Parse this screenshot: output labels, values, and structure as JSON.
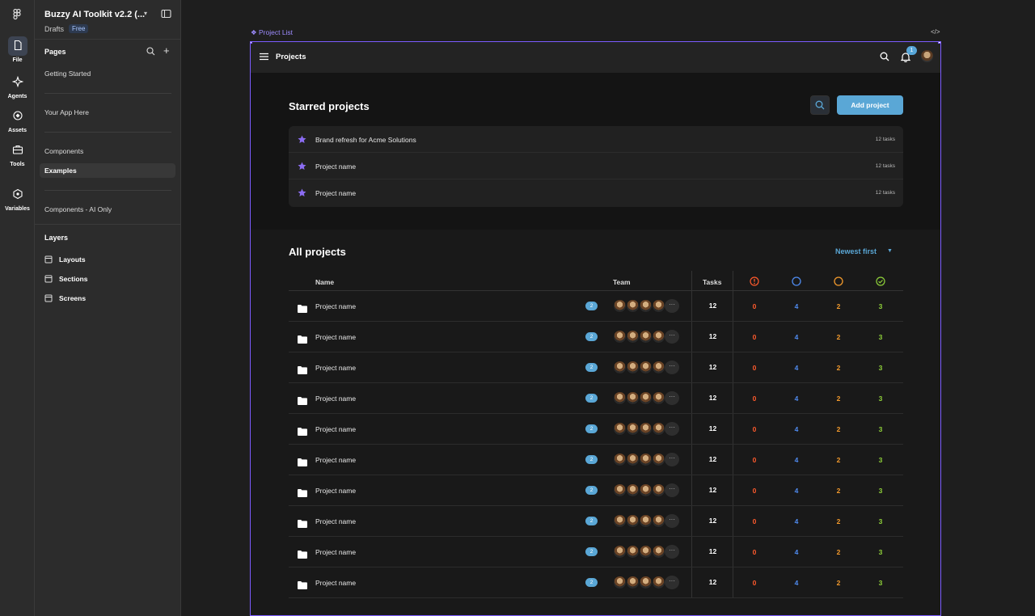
{
  "figma": {
    "file_title": "Buzzy AI Toolkit v2.2 (...",
    "drafts": "Drafts",
    "plan_badge": "Free",
    "rail": [
      {
        "label": "File",
        "icon": "file-icon"
      },
      {
        "label": "Agents",
        "icon": "agents-icon"
      },
      {
        "label": "Assets",
        "icon": "assets-icon"
      },
      {
        "label": "Tools",
        "icon": "tools-icon"
      },
      {
        "label": "Variables",
        "icon": "variables-icon"
      }
    ],
    "pages_heading": "Pages",
    "pages": [
      "Getting Started",
      "Your App Here",
      "Components",
      "Examples",
      "Components - AI Only"
    ],
    "selected_page": "Examples",
    "layers_heading": "Layers",
    "layers": [
      "Layouts",
      "Sections",
      "Screens"
    ],
    "frame_label": "Project List",
    "frame_code_icon": "</>"
  },
  "app": {
    "topbar_title": "Projects",
    "notification_count": "1",
    "starred_title": "Starred projects",
    "add_button": "Add project",
    "starred": [
      {
        "name": "Brand refresh for Acme Solutions",
        "tasks": "12 tasks"
      },
      {
        "name": "Project name",
        "tasks": "12 tasks"
      },
      {
        "name": "Project name",
        "tasks": "12 tasks"
      }
    ],
    "all_title": "All projects",
    "sort_label": "Newest first",
    "columns": {
      "name": "Name",
      "team": "Team",
      "tasks": "Tasks"
    },
    "status_colors": {
      "overdue": "#ff5a2c",
      "todo": "#4f8bf0",
      "in_progress": "#f39a2c",
      "done": "#8fd13a"
    },
    "rows": [
      {
        "name": "Project name",
        "badge": "2",
        "tasks": "12",
        "overdue": "0",
        "todo": "4",
        "in_progress": "2",
        "done": "3"
      },
      {
        "name": "Project name",
        "badge": "2",
        "tasks": "12",
        "overdue": "0",
        "todo": "4",
        "in_progress": "2",
        "done": "3"
      },
      {
        "name": "Project name",
        "badge": "2",
        "tasks": "12",
        "overdue": "0",
        "todo": "4",
        "in_progress": "2",
        "done": "3"
      },
      {
        "name": "Project name",
        "badge": "2",
        "tasks": "12",
        "overdue": "0",
        "todo": "4",
        "in_progress": "2",
        "done": "3"
      },
      {
        "name": "Project name",
        "badge": "2",
        "tasks": "12",
        "overdue": "0",
        "todo": "4",
        "in_progress": "2",
        "done": "3"
      },
      {
        "name": "Project name",
        "badge": "2",
        "tasks": "12",
        "overdue": "0",
        "todo": "4",
        "in_progress": "2",
        "done": "3"
      },
      {
        "name": "Project name",
        "badge": "2",
        "tasks": "12",
        "overdue": "0",
        "todo": "4",
        "in_progress": "2",
        "done": "3"
      },
      {
        "name": "Project name",
        "badge": "2",
        "tasks": "12",
        "overdue": "0",
        "todo": "4",
        "in_progress": "2",
        "done": "3"
      },
      {
        "name": "Project name",
        "badge": "2",
        "tasks": "12",
        "overdue": "0",
        "todo": "4",
        "in_progress": "2",
        "done": "3"
      },
      {
        "name": "Project name",
        "badge": "2",
        "tasks": "12",
        "overdue": "0",
        "todo": "4",
        "in_progress": "2",
        "done": "3"
      }
    ]
  }
}
